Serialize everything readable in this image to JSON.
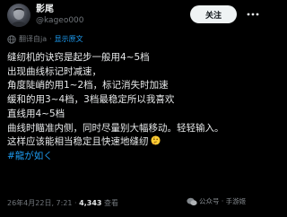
{
  "author": {
    "display_name": "影尾",
    "handle": "@kageo000"
  },
  "actions": {
    "follow_label": "关注",
    "more_icon": "more-dots-icon"
  },
  "translation": {
    "translated_from": "翻译自ja",
    "show_original": "显示原文"
  },
  "post": {
    "lines": [
      "缝纫机的诀窍是起步一般用4~5档",
      "出现曲线标记时减速，",
      "角度陡峭的用1~2档，标记消失时加速",
      "缓和的用3~4档，3档最稳定所以我喜欢",
      "直线用4~5档",
      "曲线时瞄准内侧，同时尽量别大幅移动。轻轻输入。",
      "这样应该能相当稳定且快速地缝纫"
    ],
    "emoji": "thinking-face-icon",
    "hashtag": "#龍が如く"
  },
  "meta": {
    "timestamp": "26年4月22日, 7:21",
    "separator": " · ",
    "views": "4,343",
    "views_label": " 查看"
  },
  "watermark": {
    "text": "公众号 · 手游姬"
  },
  "colors": {
    "background": "#000000",
    "text": "#e7e9ea",
    "muted": "#71767b",
    "link": "#1d9bf0",
    "button_bg": "#eff3f4"
  }
}
